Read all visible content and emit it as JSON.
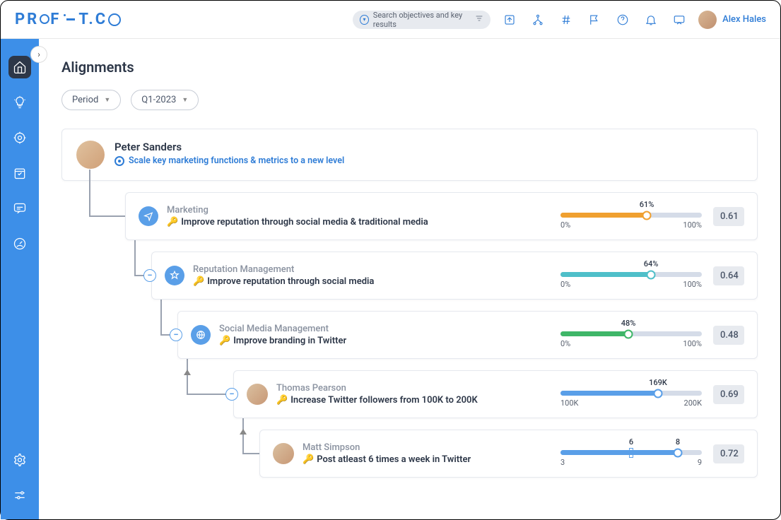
{
  "topbar": {
    "logo_text_1": "PR",
    "logo_text_2": "F",
    "logo_text_3": "T.C",
    "search_placeholder": "Search objectives and key results",
    "user_name": "Alex Hales"
  },
  "page_title": "Alignments",
  "filters": {
    "period_label": "Period",
    "quarter_label": "Q1-2023"
  },
  "root": {
    "name": "Peter Sanders",
    "objective": "Scale key marketing functions & metrics to a new level"
  },
  "nodes": [
    {
      "category": "Marketing",
      "title": "Improve reputation through social media & traditional media",
      "min": "0%",
      "max": "100%",
      "value_label": "61%",
      "percent": 61,
      "score": "0.61",
      "color": "#f0a030",
      "indent": 90
    },
    {
      "category": "Reputation Management",
      "title": "Improve reputation through social media",
      "min": "0%",
      "max": "100%",
      "value_label": "64%",
      "percent": 64,
      "score": "0.64",
      "color": "#4fbfc9",
      "indent": 127
    },
    {
      "category": "Social Media Management",
      "title": "Improve branding in Twitter",
      "min": "0%",
      "max": "100%",
      "value_label": "48%",
      "percent": 48,
      "score": "0.48",
      "color": "#3fb668",
      "indent": 164
    },
    {
      "category": "Thomas Pearson",
      "title": "Increase Twitter followers from 100K to 200K",
      "min": "100K",
      "max": "200K",
      "value_label": "169K",
      "percent": 69,
      "score": "0.69",
      "color": "#5a9fe8",
      "indent": 243,
      "avatar": true
    },
    {
      "category": "Matt Simpson",
      "title": "Post atleast 6 times a week in Twitter",
      "min": "3",
      "max": "9",
      "value_label_a": "6",
      "value_label_b": "8",
      "percent": 83,
      "marker_percent": 50,
      "score": "0.72",
      "color": "#5a9fe8",
      "indent": 280,
      "avatar": true,
      "dual": true
    }
  ]
}
